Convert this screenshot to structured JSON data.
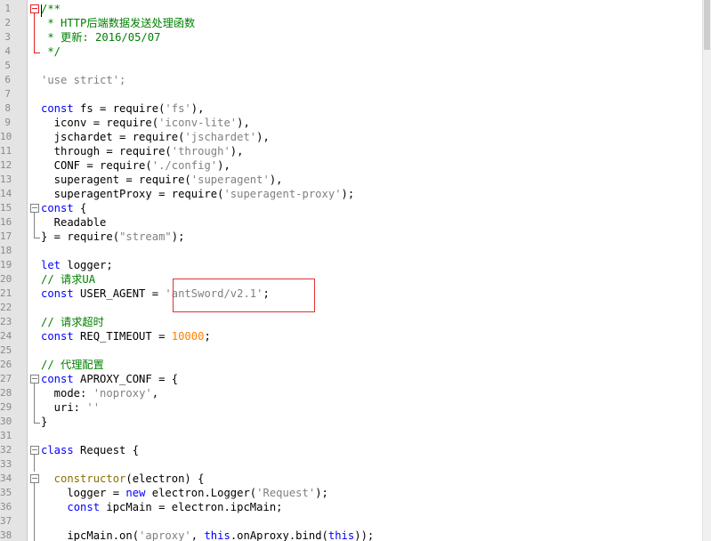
{
  "editor": {
    "lines": [
      {
        "n": "1",
        "fold": "start-red",
        "tokens": [
          {
            "t": "/**",
            "c": "cm"
          }
        ]
      },
      {
        "n": "2",
        "fold": "line-red",
        "tokens": [
          {
            "t": " * HTTP后端数据发送处理函数",
            "c": "cm"
          }
        ]
      },
      {
        "n": "3",
        "fold": "line-red",
        "tokens": [
          {
            "t": " * 更新: 2016/05/07",
            "c": "cm"
          }
        ]
      },
      {
        "n": "4",
        "fold": "end-red",
        "tokens": [
          {
            "t": " */",
            "c": "cm"
          }
        ]
      },
      {
        "n": "5",
        "fold": "",
        "tokens": []
      },
      {
        "n": "6",
        "fold": "",
        "tokens": [
          {
            "t": "'use strict';",
            "c": "str"
          }
        ]
      },
      {
        "n": "7",
        "fold": "",
        "tokens": []
      },
      {
        "n": "8",
        "fold": "",
        "tokens": [
          {
            "t": "const",
            "c": "kw"
          },
          {
            "t": " fs = require(",
            "c": "id"
          },
          {
            "t": "'fs'",
            "c": "str"
          },
          {
            "t": "),",
            "c": "id"
          }
        ]
      },
      {
        "n": "9",
        "fold": "",
        "tokens": [
          {
            "t": "  iconv = require(",
            "c": "id"
          },
          {
            "t": "'iconv-lite'",
            "c": "str"
          },
          {
            "t": "),",
            "c": "id"
          }
        ]
      },
      {
        "n": "10",
        "fold": "",
        "tokens": [
          {
            "t": "  jschardet = require(",
            "c": "id"
          },
          {
            "t": "'jschardet'",
            "c": "str"
          },
          {
            "t": "),",
            "c": "id"
          }
        ]
      },
      {
        "n": "11",
        "fold": "",
        "tokens": [
          {
            "t": "  through = require(",
            "c": "id"
          },
          {
            "t": "'through'",
            "c": "str"
          },
          {
            "t": "),",
            "c": "id"
          }
        ]
      },
      {
        "n": "12",
        "fold": "",
        "tokens": [
          {
            "t": "  CONF = require(",
            "c": "id"
          },
          {
            "t": "'./config'",
            "c": "str"
          },
          {
            "t": "),",
            "c": "id"
          }
        ]
      },
      {
        "n": "13",
        "fold": "",
        "tokens": [
          {
            "t": "  superagent = require(",
            "c": "id"
          },
          {
            "t": "'superagent'",
            "c": "str"
          },
          {
            "t": "),",
            "c": "id"
          }
        ]
      },
      {
        "n": "14",
        "fold": "",
        "tokens": [
          {
            "t": "  superagentProxy = require(",
            "c": "id"
          },
          {
            "t": "'superagent-proxy'",
            "c": "str"
          },
          {
            "t": ");",
            "c": "id"
          }
        ]
      },
      {
        "n": "15",
        "fold": "start",
        "tokens": [
          {
            "t": "const",
            "c": "kw"
          },
          {
            "t": " {",
            "c": "id"
          }
        ]
      },
      {
        "n": "16",
        "fold": "line",
        "tokens": [
          {
            "t": "  Readable",
            "c": "id"
          }
        ]
      },
      {
        "n": "17",
        "fold": "end",
        "tokens": [
          {
            "t": "} = require(",
            "c": "id"
          },
          {
            "t": "\"stream\"",
            "c": "str"
          },
          {
            "t": ");",
            "c": "id"
          }
        ]
      },
      {
        "n": "18",
        "fold": "",
        "tokens": []
      },
      {
        "n": "19",
        "fold": "",
        "tokens": [
          {
            "t": "let",
            "c": "kw"
          },
          {
            "t": " logger;",
            "c": "id"
          }
        ]
      },
      {
        "n": "20",
        "fold": "",
        "tokens": [
          {
            "t": "// 请求UA",
            "c": "cm"
          }
        ]
      },
      {
        "n": "21",
        "fold": "",
        "tokens": [
          {
            "t": "const",
            "c": "kw"
          },
          {
            "t": " USER_AGENT = ",
            "c": "id"
          },
          {
            "t": "'antSword/v2.1'",
            "c": "str"
          },
          {
            "t": ";",
            "c": "id"
          }
        ]
      },
      {
        "n": "22",
        "fold": "",
        "tokens": []
      },
      {
        "n": "23",
        "fold": "",
        "tokens": [
          {
            "t": "// 请求超时",
            "c": "cm"
          }
        ]
      },
      {
        "n": "24",
        "fold": "",
        "tokens": [
          {
            "t": "const",
            "c": "kw"
          },
          {
            "t": " REQ_TIMEOUT = ",
            "c": "id"
          },
          {
            "t": "10000",
            "c": "num"
          },
          {
            "t": ";",
            "c": "id"
          }
        ]
      },
      {
        "n": "25",
        "fold": "",
        "tokens": []
      },
      {
        "n": "26",
        "fold": "",
        "tokens": [
          {
            "t": "// 代理配置",
            "c": "cm"
          }
        ]
      },
      {
        "n": "27",
        "fold": "start",
        "tokens": [
          {
            "t": "const",
            "c": "kw"
          },
          {
            "t": " APROXY_CONF = {",
            "c": "id"
          }
        ]
      },
      {
        "n": "28",
        "fold": "line",
        "tokens": [
          {
            "t": "  mode: ",
            "c": "id"
          },
          {
            "t": "'noproxy'",
            "c": "str"
          },
          {
            "t": ",",
            "c": "id"
          }
        ]
      },
      {
        "n": "29",
        "fold": "line",
        "tokens": [
          {
            "t": "  uri: ",
            "c": "id"
          },
          {
            "t": "''",
            "c": "str"
          }
        ]
      },
      {
        "n": "30",
        "fold": "end",
        "tokens": [
          {
            "t": "}",
            "c": "id"
          }
        ]
      },
      {
        "n": "31",
        "fold": "",
        "tokens": []
      },
      {
        "n": "32",
        "fold": "start",
        "tokens": [
          {
            "t": "class",
            "c": "kw"
          },
          {
            "t": " Request {",
            "c": "id"
          }
        ]
      },
      {
        "n": "33",
        "fold": "line",
        "tokens": []
      },
      {
        "n": "34",
        "fold": "start-nested",
        "tokens": [
          {
            "t": "  constructor",
            "c": "fn"
          },
          {
            "t": "(electron) {",
            "c": "id"
          }
        ]
      },
      {
        "n": "35",
        "fold": "line",
        "tokens": [
          {
            "t": "    logger = ",
            "c": "id"
          },
          {
            "t": "new",
            "c": "kw"
          },
          {
            "t": " electron.Logger(",
            "c": "id"
          },
          {
            "t": "'Request'",
            "c": "str"
          },
          {
            "t": ");",
            "c": "id"
          }
        ]
      },
      {
        "n": "36",
        "fold": "line",
        "tokens": [
          {
            "t": "    ",
            "c": "id"
          },
          {
            "t": "const",
            "c": "kw"
          },
          {
            "t": " ipcMain = electron.ipcMain;",
            "c": "id"
          }
        ]
      },
      {
        "n": "37",
        "fold": "line",
        "tokens": []
      },
      {
        "n": "38",
        "fold": "line",
        "tokens": [
          {
            "t": "    ipcMain.on(",
            "c": "id"
          },
          {
            "t": "'aproxy'",
            "c": "str"
          },
          {
            "t": ", ",
            "c": "id"
          },
          {
            "t": "this",
            "c": "kw"
          },
          {
            "t": ".onAproxy.bind(",
            "c": "id"
          },
          {
            "t": "this",
            "c": "kw"
          },
          {
            "t": "));",
            "c": "id"
          }
        ]
      }
    ]
  }
}
